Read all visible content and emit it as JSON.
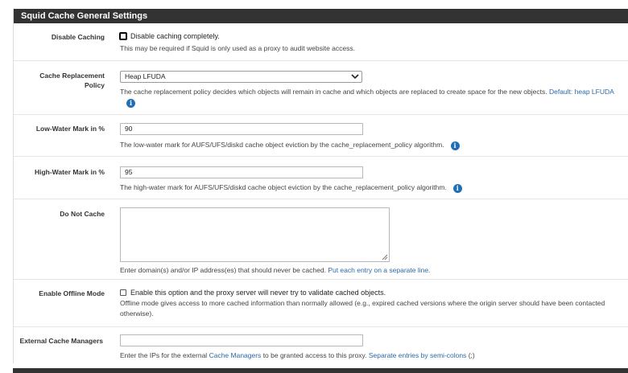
{
  "panel": {
    "title": "Squid Cache General Settings"
  },
  "disable_caching": {
    "label": "Disable Caching",
    "checkbox_label": "Disable caching completely.",
    "help": "This may be required if Squid is only used as a proxy to audit website access."
  },
  "replacement_policy": {
    "label_line1": "Cache Replacement",
    "label_line2": "Policy",
    "selected": "Heap LFUDA",
    "help_text": "The cache replacement policy decides which objects will remain in cache and which objects are replaced to create space for the new objects.",
    "help_default": "Default:",
    "help_default_value": "heap LFUDA"
  },
  "low_water": {
    "label": "Low-Water Mark in %",
    "value": "90",
    "help": "The low-water mark for AUFS/UFS/diskd cache object eviction by the cache_replacement_policy algorithm."
  },
  "high_water": {
    "label": "High-Water Mark in %",
    "value": "95",
    "help": "The high-water mark for AUFS/UFS/diskd cache object eviction by the cache_replacement_policy algorithm."
  },
  "do_not_cache": {
    "label": "Do Not Cache",
    "value": "",
    "help_text": "Enter domain(s) and/or IP address(es) that should never be cached.",
    "help_link": "Put each entry on a separate line."
  },
  "offline_mode": {
    "label": "Enable Offline Mode",
    "checkbox_label": "Enable this option and the proxy server will never try to validate cached objects.",
    "help": "Offline mode gives access to more cached information than normally allowed (e.g., expired cached versions where the origin server should have been contacted otherwise)."
  },
  "external_managers": {
    "label": "External Cache Managers",
    "value": "",
    "help_pre": "Enter the IPs for the external",
    "help_link1": "Cache Managers",
    "help_mid": "to be granted access to this proxy.",
    "help_link2": "Separate entries by semi-colons",
    "help_post": "(;)"
  },
  "icons": {
    "info": "info-icon",
    "chevron": "chevron-down-icon",
    "resize": "resize-grip-icon"
  }
}
